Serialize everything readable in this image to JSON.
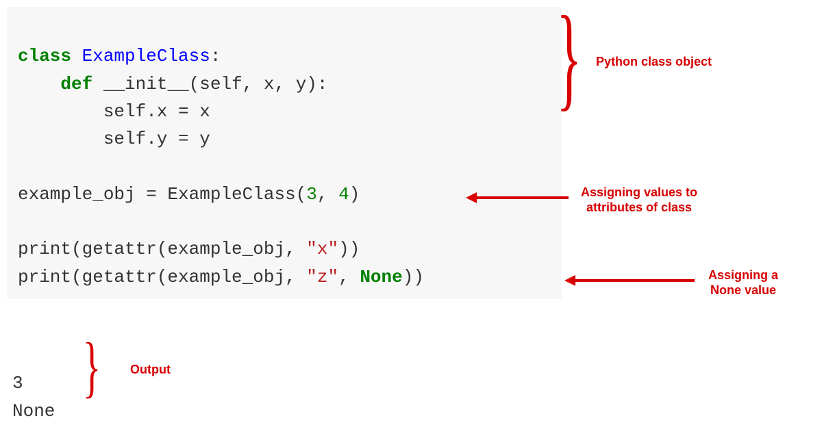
{
  "code": {
    "line1": {
      "kw_class": "class",
      "sp1": " ",
      "cls_name": "ExampleClass",
      "colon": ":"
    },
    "line2": {
      "indent": "    ",
      "kw_def": "def",
      "sp1": " ",
      "fn": "__init__",
      "sig": "(self, x, y):"
    },
    "line3": {
      "indent": "        ",
      "text": "self.x = x"
    },
    "line4": {
      "indent": "        ",
      "text": "self.y = y"
    },
    "line5": {
      "text": ""
    },
    "line6": {
      "a": "example_obj = ExampleClass(",
      "n1": "3",
      "c": ", ",
      "n2": "4",
      "close": ")"
    },
    "line7": {
      "text": ""
    },
    "line8": {
      "a": "print(getattr(example_obj, ",
      "s": "\"x\"",
      "close": "))"
    },
    "line9": {
      "a": "print(getattr(example_obj, ",
      "s": "\"z\"",
      "c": ", ",
      "none": "None",
      "close": "))"
    }
  },
  "output": {
    "line1": "3",
    "line2": "None"
  },
  "annotations": {
    "class_obj": "Python class object",
    "assign_vals_l1": "Assigning values to",
    "assign_vals_l2": "attributes of class",
    "assign_none_l1": "Assigning a",
    "assign_none_l2": "None value",
    "output_label": "Output"
  }
}
